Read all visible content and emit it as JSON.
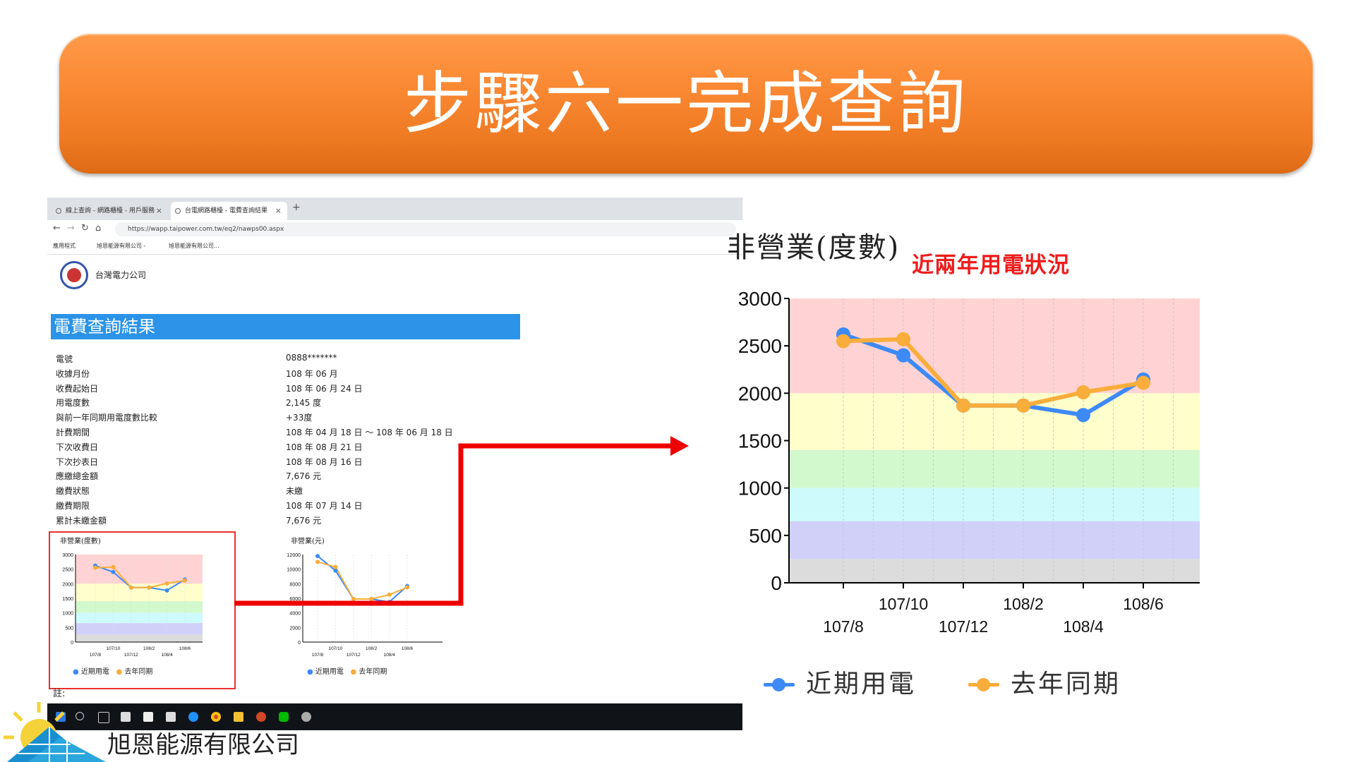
{
  "slide": {
    "title": "步驟六一完成查詢",
    "company": "旭恩能源有限公司"
  },
  "browser": {
    "tabs": [
      {
        "label": "線上查詢 - 網路櫃檯 - 用戶服務"
      },
      {
        "label": "台電網路櫃檯 - 電費查詢結果"
      }
    ],
    "close_glyph": "×",
    "new_tab_glyph": "+",
    "url": "https://wapp.taipower.com.tw/eq2/nawps00.aspx",
    "bookmarks": [
      "應用程式",
      "旭恩能源有限公司 -",
      "旭恩能源有限公司..."
    ]
  },
  "page": {
    "logo_text": "台灣電力公司",
    "result_heading": "電費查詢結果",
    "fields": [
      {
        "label": "電號",
        "value": "0888*******"
      },
      {
        "label": "收據月份",
        "value": "108 年 06 月"
      },
      {
        "label": "收費起始日",
        "value": "108 年 06 月 24 日"
      },
      {
        "label": "用電度數",
        "value": "2,145 度"
      },
      {
        "label": "與前一年同期用電度數比較",
        "value": "+33度"
      },
      {
        "label": "計費期間",
        "value": "108 年 04 月 18 日 ～ 108 年 06 月 18 日"
      },
      {
        "label": "下次收費日",
        "value": "108 年 08 月 21 日"
      },
      {
        "label": "下次抄表日",
        "value": "108 年 08 月 16 日"
      },
      {
        "label": "應繳總金額",
        "value": "7,676 元"
      },
      {
        "label": "繳費狀態",
        "value": "未繳"
      },
      {
        "label": "繳費期限",
        "value": "108 年 07 月 14 日"
      },
      {
        "label": "累計未繳金額",
        "value": "7,676 元"
      }
    ],
    "note": "註:",
    "mini_chart_kwh_title": "非營業(度數)",
    "mini_chart_ntd_title": "非營業(元)",
    "legend_recent": "近期用電",
    "legend_lastyear": "去年同期"
  },
  "annotation": {
    "subtitle": "近兩年用電狀況"
  },
  "colors": {
    "banner": "#f5822a",
    "heading_bar": "#2b93e8",
    "recent_series": "#3d8af7",
    "lastyear_series": "#f9ad3b",
    "annotation_red": "#ee1c1c"
  },
  "chart_data": [
    {
      "type": "line",
      "title": "非營業(度數)",
      "categories": [
        "107/8",
        "107/10",
        "107/12",
        "108/2",
        "108/4",
        "108/6"
      ],
      "series": [
        {
          "name": "近期用電",
          "values": [
            2620,
            2400,
            1870,
            1870,
            1770,
            2145
          ]
        },
        {
          "name": "去年同期",
          "values": [
            2550,
            2570,
            1870,
            1870,
            2010,
            2110
          ]
        }
      ],
      "ylim": [
        0,
        3000
      ],
      "yticks": [
        0,
        500,
        1000,
        1500,
        2000,
        2500,
        3000
      ],
      "bands": [
        {
          "from": 2000,
          "to": 3000,
          "color": "#ffd3d3"
        },
        {
          "from": 1400,
          "to": 2000,
          "color": "#ffffcc"
        },
        {
          "from": 1000,
          "to": 1400,
          "color": "#d2f8cd"
        },
        {
          "from": 650,
          "to": 1000,
          "color": "#cdfbfb"
        },
        {
          "from": 250,
          "to": 650,
          "color": "#d0d0f8"
        },
        {
          "from": 0,
          "to": 250,
          "color": "#dcdcdc"
        }
      ],
      "legend": "bottom"
    },
    {
      "type": "line",
      "title": "非營業(元)",
      "categories": [
        "107/8",
        "107/10",
        "107/12",
        "108/2",
        "108/4",
        "108/6"
      ],
      "series": [
        {
          "name": "近期用電",
          "values": [
            11800,
            9800,
            5900,
            5900,
            5500,
            7676
          ]
        },
        {
          "name": "去年同期",
          "values": [
            11000,
            10300,
            5900,
            5900,
            6500,
            7500
          ]
        }
      ],
      "ylim": [
        0,
        12000
      ],
      "yticks": [
        0,
        2000,
        4000,
        6000,
        8000,
        10000,
        12000
      ],
      "legend": "bottom"
    }
  ]
}
